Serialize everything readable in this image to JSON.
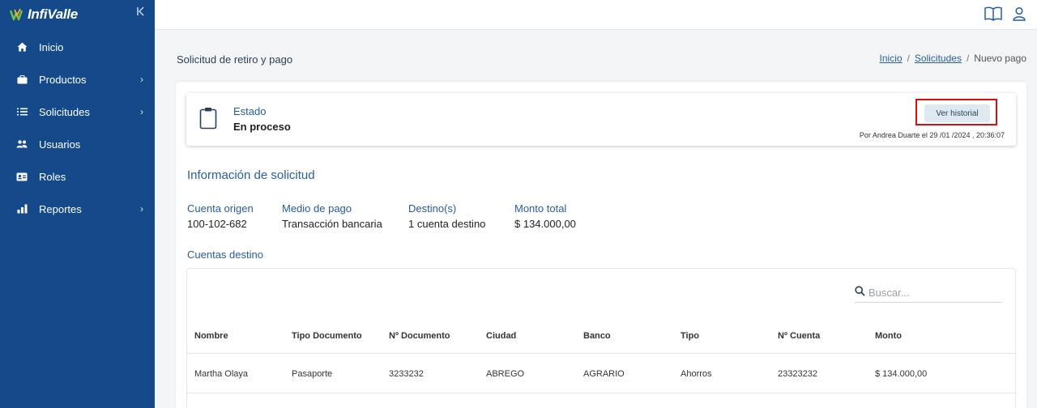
{
  "brand": {
    "name": "InfiValle"
  },
  "sidebar": {
    "items": [
      {
        "label": "Inicio",
        "icon": "home-icon",
        "has_children": false
      },
      {
        "label": "Productos",
        "icon": "briefcase-icon",
        "has_children": true
      },
      {
        "label": "Solicitudes",
        "icon": "list-icon",
        "has_children": true
      },
      {
        "label": "Usuarios",
        "icon": "users-icon",
        "has_children": false
      },
      {
        "label": "Roles",
        "icon": "id-card-icon",
        "has_children": false
      },
      {
        "label": "Reportes",
        "icon": "bar-chart-icon",
        "has_children": true
      }
    ]
  },
  "header": {
    "title": "Solicitud de retiro y pago",
    "breadcrumb": {
      "home": "Inicio",
      "requests": "Solicitudes",
      "current": "Nuevo pago",
      "separator": "/"
    }
  },
  "status": {
    "label": "Estado",
    "value": "En proceso",
    "history_button": "Ver historial",
    "meta": "Por Andrea Duarte el 29 /01 /2024 , 20:36:07"
  },
  "info": {
    "title": "Información de solicitud",
    "fields": [
      {
        "label": "Cuenta origen",
        "value": "100-102-682"
      },
      {
        "label": "Medio de pago",
        "value": "Transacción bancaria"
      },
      {
        "label": "Destino(s)",
        "value": "1 cuenta destino"
      },
      {
        "label": "Monto total",
        "value": "$ 134.000,00"
      }
    ]
  },
  "accounts": {
    "title": "Cuentas destino",
    "search_placeholder": "Buscar...",
    "columns": [
      "Nombre",
      "Tipo Documento",
      "Nº Documento",
      "Ciudad",
      "Banco",
      "Tipo",
      "Nº Cuenta",
      "Monto"
    ],
    "rows": [
      [
        "Martha Olaya",
        "Pasaporte",
        "3233232",
        "ABREGO",
        "AGRARIO",
        "Ahorros",
        "23323232",
        "$ 134.000,00"
      ]
    ]
  },
  "colors": {
    "sidebar": "#144a8a",
    "accent": "#2a5d97",
    "highlight_frame": "#d40f0f"
  }
}
